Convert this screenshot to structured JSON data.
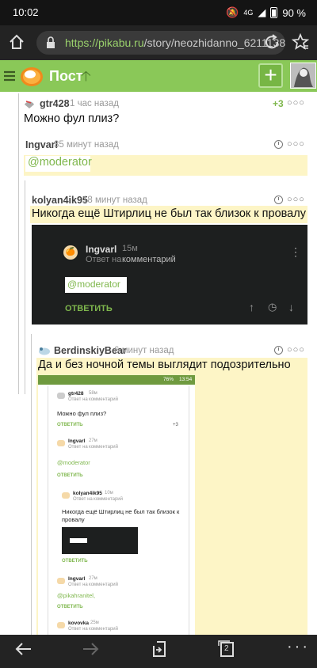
{
  "status": {
    "time": "10:02",
    "battery": "90 %",
    "network": "4G"
  },
  "browser": {
    "url_host": "https://pikabu.ru",
    "url_path": "/story/neozhidanno_6211138",
    "tabs_count": "2"
  },
  "header": {
    "title": "Пост"
  },
  "comments": [
    {
      "user": "gtr428",
      "time": "1 час назад",
      "rating": "+3",
      "text": "Можно фул плиз?"
    },
    {
      "user": "Ingvarl",
      "time": "35 минут назад",
      "text": "@moderator"
    },
    {
      "user": "kolyan4ik95",
      "time": "18 минут назад",
      "text": "Никогда ещё Штирлиц не был так близок к провалу",
      "embed": {
        "user": "Ingvarl",
        "time": "15м",
        "reply_prefix": "Ответ на",
        "reply_link": "комментарий",
        "text": "@moderator",
        "reply_button": "ОТВЕТИТЬ"
      }
    },
    {
      "user": "BerdinskiyBear",
      "time": "6 минут назад",
      "text": "Да и без ночной темы выглядит подозрительно"
    }
  ],
  "screenshot": {
    "status": {
      "battery": "76%",
      "time": "13:54"
    },
    "reply_prefix": "Ответ на",
    "reply_link": "комментарий",
    "reply_button": "ОТВЕТИТЬ",
    "items": [
      {
        "user": "gtr428",
        "time": "58м",
        "text": "Можно фул плиз?",
        "rating": "+3"
      },
      {
        "user": "Ingvarl",
        "time": "27м",
        "text": "@moderator"
      },
      {
        "user": "kolyan4ik95",
        "time": "10м",
        "text": "Никогда ещё Штирлиц не был так близок к провалу"
      },
      {
        "user": "Ingvarl",
        "time": "27м",
        "text": "@pikahranitel,"
      },
      {
        "user": "kovovka",
        "time": "25м",
        "text": ""
      }
    ]
  }
}
